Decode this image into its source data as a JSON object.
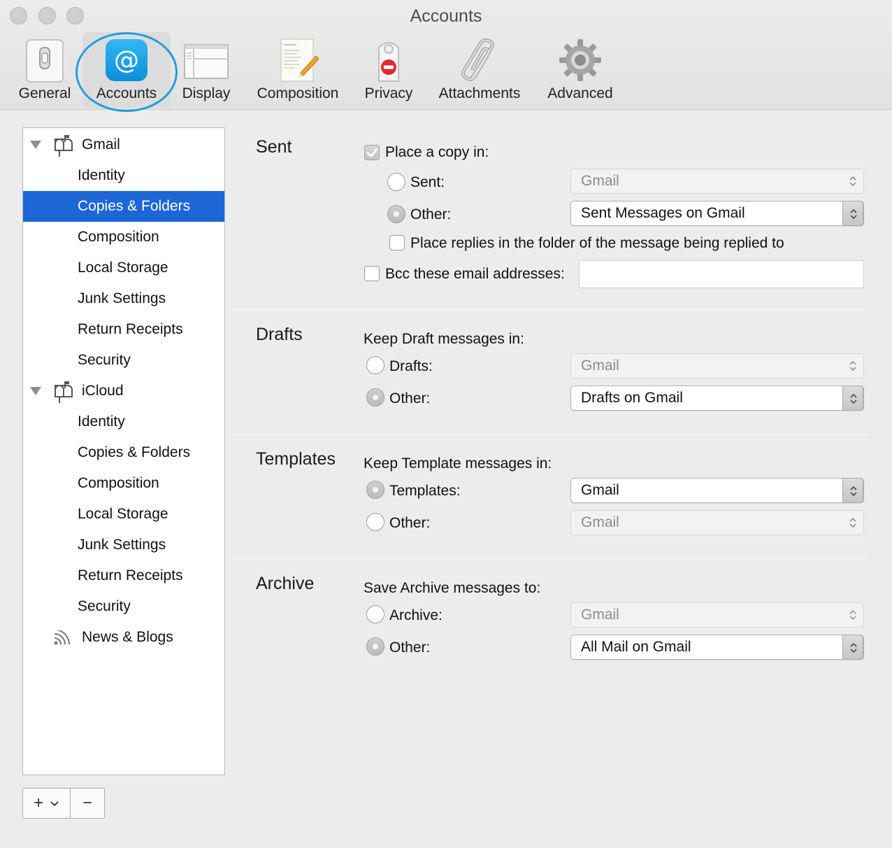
{
  "window": {
    "title": "Accounts"
  },
  "toolbar": {
    "items": [
      {
        "label": "General",
        "icon": "general-switch-icon"
      },
      {
        "label": "Accounts",
        "icon": "at-sign-icon"
      },
      {
        "label": "Display",
        "icon": "display-window-icon"
      },
      {
        "label": "Composition",
        "icon": "letter-pencil-icon"
      },
      {
        "label": "Privacy",
        "icon": "do-not-disturb-tag-icon"
      },
      {
        "label": "Attachments",
        "icon": "paperclip-icon"
      },
      {
        "label": "Advanced",
        "icon": "gear-icon"
      }
    ],
    "selected": "Accounts"
  },
  "sidebar": {
    "accounts": [
      {
        "name": "Gmail",
        "icon": "mailbox-icon",
        "items": [
          "Identity",
          "Copies & Folders",
          "Composition",
          "Local Storage",
          "Junk Settings",
          "Return Receipts",
          "Security"
        ]
      },
      {
        "name": "iCloud",
        "icon": "mailbox-icon",
        "items": [
          "Identity",
          "Copies & Folders",
          "Composition",
          "Local Storage",
          "Junk Settings",
          "Return Receipts",
          "Security"
        ]
      }
    ],
    "feeds": {
      "name": "News & Blogs",
      "icon": "rss-icon"
    },
    "selected": "Gmail / Copies & Folders",
    "add_label": "+",
    "remove_label": "−"
  },
  "sent": {
    "title": "Sent",
    "place_copy_label": "Place a copy in:",
    "place_copy_checked": true,
    "sent_label": "Sent:",
    "sent_value": "Gmail",
    "other_label": "Other:",
    "other_value": "Sent Messages on Gmail",
    "selected_option": "Other",
    "replies_label": "Place replies in the folder of the message being replied to",
    "replies_checked": false,
    "bcc_label": "Bcc these email addresses:",
    "bcc_checked": false,
    "bcc_value": ""
  },
  "drafts": {
    "title": "Drafts",
    "heading": "Keep Draft messages in:",
    "drafts_label": "Drafts:",
    "drafts_value": "Gmail",
    "other_label": "Other:",
    "other_value": "Drafts on Gmail",
    "selected_option": "Other"
  },
  "templates": {
    "title": "Templates",
    "heading": "Keep Template messages in:",
    "templates_label": "Templates:",
    "templates_value": "Gmail",
    "other_label": "Other:",
    "other_value": "Gmail",
    "selected_option": "Templates"
  },
  "archive": {
    "title": "Archive",
    "heading": "Save Archive messages to:",
    "archive_label": "Archive:",
    "archive_value": "Gmail",
    "other_label": "Other:",
    "other_value": "All Mail on Gmail",
    "selected_option": "Other"
  },
  "colors": {
    "selection": "#1c66d6",
    "highlight_ring": "#1e9fe0",
    "accounts_icon": "#1aa1e8"
  }
}
